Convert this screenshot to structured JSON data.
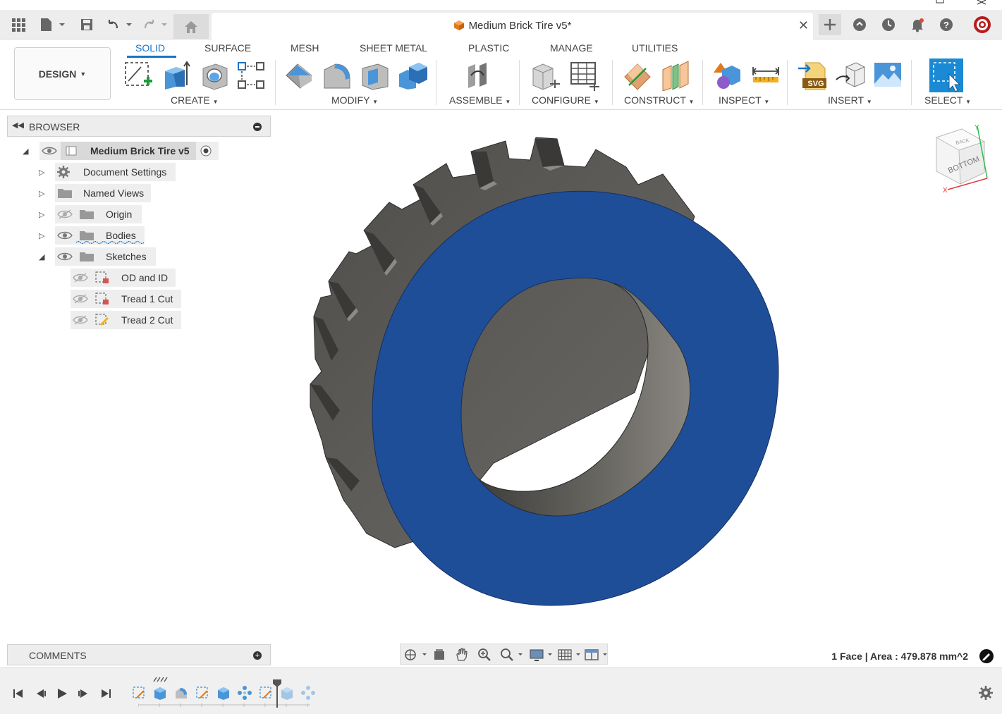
{
  "window": {
    "document_title": "Medium Brick Tire v5*"
  },
  "ribbon": {
    "workspace_label": "DESIGN",
    "tabs": [
      {
        "label": "SOLID",
        "active": true
      },
      {
        "label": "SURFACE"
      },
      {
        "label": "MESH"
      },
      {
        "label": "SHEET METAL"
      },
      {
        "label": "PLASTIC"
      },
      {
        "label": "MANAGE"
      },
      {
        "label": "UTILITIES"
      }
    ],
    "groups": {
      "create": "CREATE",
      "modify": "MODIFY",
      "assemble": "ASSEMBLE",
      "configure": "CONFIGURE",
      "construct": "CONSTRUCT",
      "inspect": "INSPECT",
      "insert": "INSERT",
      "select": "SELECT"
    }
  },
  "browser": {
    "header": "BROWSER",
    "root": "Medium Brick Tire v5",
    "items": [
      {
        "label": "Document Settings"
      },
      {
        "label": "Named Views"
      },
      {
        "label": "Origin"
      },
      {
        "label": "Bodies"
      },
      {
        "label": "Sketches"
      }
    ],
    "sketches": [
      {
        "label": "OD and ID"
      },
      {
        "label": "Tread 1 Cut"
      },
      {
        "label": "Tread 2 Cut"
      }
    ]
  },
  "viewcube": {
    "face": "BOTTOM",
    "back": "BACK",
    "axis_y": "Y",
    "axis_x": "X"
  },
  "comments": {
    "label": "COMMENTS"
  },
  "status": {
    "selection_info": "1 Face | Area : 479.878 mm^2"
  },
  "colors": {
    "accent": "#1a73c7",
    "face_selected": "#1f4e99",
    "body_gray": "#5a5855",
    "select_button": "#1a8ad4"
  }
}
